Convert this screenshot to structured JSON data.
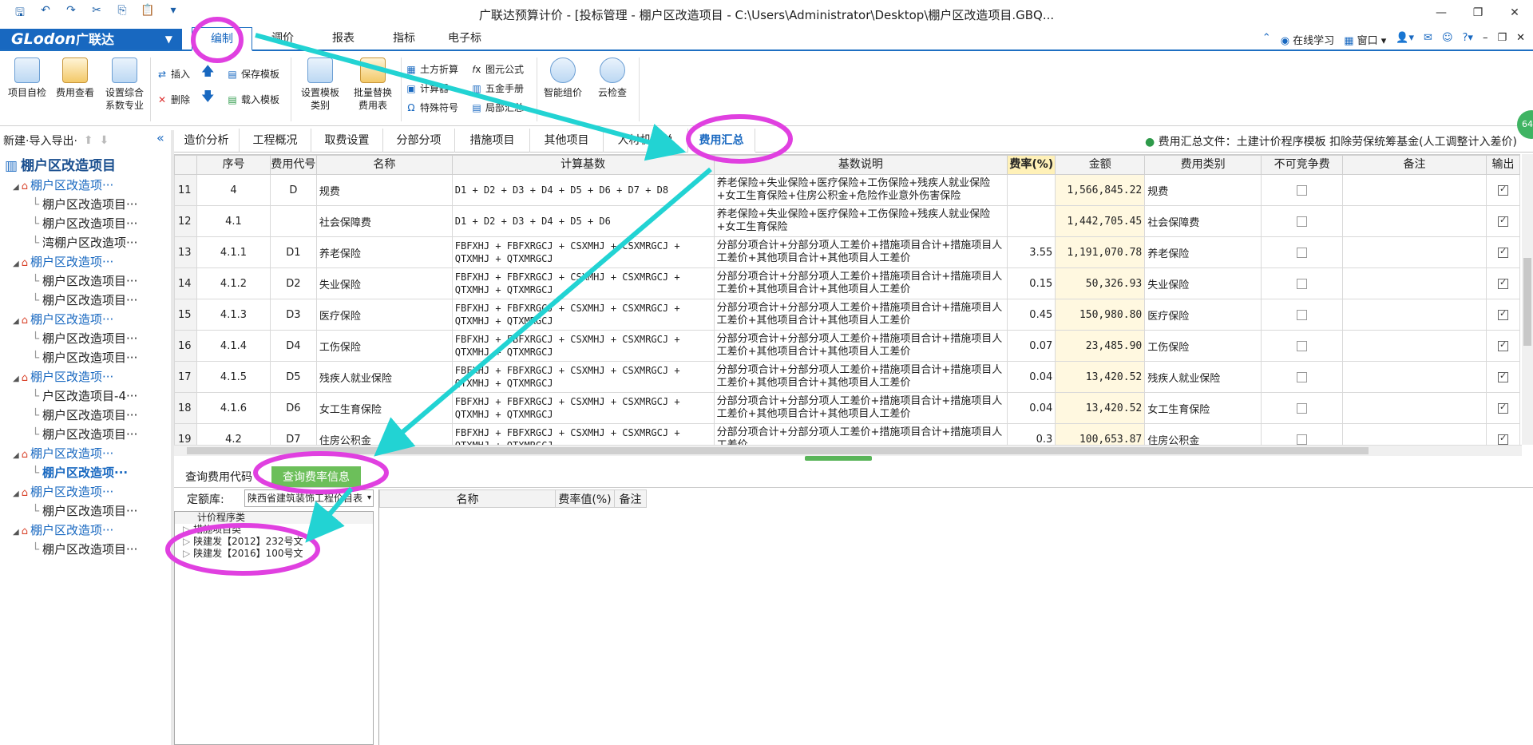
{
  "window": {
    "title": "广联达预算计价 - [投标管理 - 棚户区改造项目 - C:\\Users\\Administrator\\Desktop\\棚户区改造项目.GBQ..."
  },
  "logo": {
    "latin": "GLodon",
    "cn": "广联达"
  },
  "menu": [
    "编制",
    "调价",
    "报表",
    "指标",
    "电子标"
  ],
  "menu_right": {
    "online": "在线学习",
    "window": "窗口"
  },
  "ribbon": {
    "self_check": "项目自检",
    "fee_view": "费用查看",
    "set_rate": "设置综合",
    "set_rate2": "系数专业",
    "insert": "插入",
    "delete": "删除",
    "save_tpl": "保存模板",
    "load_tpl": "载入模板",
    "set_tpl_cat": "设置模板",
    "set_tpl_cat2": "类别",
    "batch_replace": "批量替换",
    "batch_replace2": "费用表",
    "earthwork": "土方折算",
    "calculator": "计算器",
    "special_symbol": "特殊符号",
    "element_formula": "图元公式",
    "hardware_manual": "五金手册",
    "local_summary": "局部汇总",
    "smart_price": "智能组价",
    "cloud_check": "云检查"
  },
  "left": {
    "header": "新建·导入导出·",
    "tree": [
      {
        "label": "棚户区改造项目",
        "level": "root"
      },
      {
        "label": "棚户区改造项···",
        "level": "l1"
      },
      {
        "label": "棚户区改造项目···",
        "level": "l2"
      },
      {
        "label": "棚户区改造项目···",
        "level": "l2"
      },
      {
        "label": "湾棚户区改造项···",
        "level": "l2"
      },
      {
        "label": "棚户区改造项···",
        "level": "l1"
      },
      {
        "label": "棚户区改造项目···",
        "level": "l2"
      },
      {
        "label": "棚户区改造项目···",
        "level": "l2"
      },
      {
        "label": "棚户区改造项···",
        "level": "l1"
      },
      {
        "label": "棚户区改造项目···",
        "level": "l2"
      },
      {
        "label": "棚户区改造项目···",
        "level": "l2"
      },
      {
        "label": "棚户区改造项···",
        "level": "l1"
      },
      {
        "label": "户区改造项目-4···",
        "level": "l2"
      },
      {
        "label": "棚户区改造项目···",
        "level": "l2"
      },
      {
        "label": "棚户区改造项目···",
        "level": "l2"
      },
      {
        "label": "棚户区改造项···",
        "level": "l1"
      },
      {
        "label": "棚户区改造项···",
        "level": "l2sel"
      },
      {
        "label": "棚户区改造项···",
        "level": "l1"
      },
      {
        "label": "棚户区改造项目···",
        "level": "l2"
      },
      {
        "label": "棚户区改造项···",
        "level": "l1"
      },
      {
        "label": "棚户区改造项目···",
        "level": "l2"
      }
    ]
  },
  "tabs": [
    "造价分析",
    "工程概况",
    "取费设置",
    "分部分项",
    "措施项目",
    "其他项目",
    "人材机汇总",
    "费用汇总"
  ],
  "fee_file": {
    "label": "费用汇总文件：土建计价程序模板 扣除劳保统筹基金(人工调整计入差价)"
  },
  "columns": [
    "",
    "序号",
    "费用代号",
    "名称",
    "计算基数",
    "基数说明",
    "费率(%)",
    "金额",
    "费用类别",
    "不可竞争费",
    "备注",
    "输出"
  ],
  "rows": [
    {
      "rn": "11",
      "seq": "4",
      "code": "D",
      "name": "规费",
      "base": "D1 + D2 + D3 + D4 + D5 + D6 + D7 + D8",
      "desc": "养老保险+失业保险+医疗保险+工伤保险+残疾人就业保险+女工生育保险+住房公积金+危险作业意外伤害保险",
      "rate": "",
      "amount": "1,566,845.22",
      "cat": "规费"
    },
    {
      "rn": "12",
      "seq": "4.1",
      "code": "",
      "name": "社会保障费",
      "base": "D1 + D2 + D3 + D4 + D5 + D6",
      "desc": "养老保险+失业保险+医疗保险+工伤保险+残疾人就业保险+女工生育保险",
      "rate": "",
      "amount": "1,442,705.45",
      "cat": "社会保障费"
    },
    {
      "rn": "13",
      "seq": "4.1.1",
      "code": "D1",
      "name": "养老保险",
      "base": "FBFXHJ + FBFXRGCJ + CSXMHJ + CSXMRGCJ + QTXMHJ + QTXMRGCJ",
      "desc": "分部分项合计+分部分项人工差价+措施项目合计+措施项目人工差价+其他项目合计+其他项目人工差价",
      "rate": "3.55",
      "amount": "1,191,070.78",
      "cat": "养老保险"
    },
    {
      "rn": "14",
      "seq": "4.1.2",
      "code": "D2",
      "name": "失业保险",
      "base": "FBFXHJ + FBFXRGCJ + CSXMHJ + CSXMRGCJ + QTXMHJ + QTXMRGCJ",
      "desc": "分部分项合计+分部分项人工差价+措施项目合计+措施项目人工差价+其他项目合计+其他项目人工差价",
      "rate": "0.15",
      "amount": "50,326.93",
      "cat": "失业保险"
    },
    {
      "rn": "15",
      "seq": "4.1.3",
      "code": "D3",
      "name": "医疗保险",
      "base": "FBFXHJ + FBFXRGCJ + CSXMHJ + CSXMRGCJ + QTXMHJ + QTXMRGCJ",
      "desc": "分部分项合计+分部分项人工差价+措施项目合计+措施项目人工差价+其他项目合计+其他项目人工差价",
      "rate": "0.45",
      "amount": "150,980.80",
      "cat": "医疗保险"
    },
    {
      "rn": "16",
      "seq": "4.1.4",
      "code": "D4",
      "name": "工伤保险",
      "base": "FBFXHJ + FBFXRGCJ + CSXMHJ + CSXMRGCJ + QTXMHJ + QTXMRGCJ",
      "desc": "分部分项合计+分部分项人工差价+措施项目合计+措施项目人工差价+其他项目合计+其他项目人工差价",
      "rate": "0.07",
      "amount": "23,485.90",
      "cat": "工伤保险"
    },
    {
      "rn": "17",
      "seq": "4.1.5",
      "code": "D5",
      "name": "残疾人就业保险",
      "base": "FBFXHJ + FBFXRGCJ + CSXMHJ + CSXMRGCJ + QTXMHJ + QTXMRGCJ",
      "desc": "分部分项合计+分部分项人工差价+措施项目合计+措施项目人工差价+其他项目合计+其他项目人工差价",
      "rate": "0.04",
      "amount": "13,420.52",
      "cat": "残疾人就业保险"
    },
    {
      "rn": "18",
      "seq": "4.1.6",
      "code": "D6",
      "name": "女工生育保险",
      "base": "FBFXHJ + FBFXRGCJ + CSXMHJ + CSXMRGCJ + QTXMHJ + QTXMRGCJ",
      "desc": "分部分项合计+分部分项人工差价+措施项目合计+措施项目人工差价+其他项目合计+其他项目人工差价",
      "rate": "0.04",
      "amount": "13,420.52",
      "cat": "女工生育保险"
    },
    {
      "rn": "19",
      "seq": "4.2",
      "code": "D7",
      "name": "住房公积金",
      "base": "FBFXHJ + FBFXRGCJ + CSXMHJ + CSXMRGCJ + QTXMHJ + QTXMRGCJ",
      "desc": "分部分项合计+分部分项人工差价+措施项目合计+措施项目人工差价",
      "rate": "0.3",
      "amount": "100,653.87",
      "cat": "住房公积金"
    }
  ],
  "bottom": {
    "tab_code": "查询费用代码",
    "tab_rate": "查询费率信息",
    "dinge_label": "定额库:",
    "dinge_value": "陕西省建筑装饰工程价目表",
    "tree": [
      "计价程序类",
      "措施项目类",
      "陕建发【2012】232号文",
      "陕建发【2016】100号文"
    ],
    "right_cols": [
      "名称",
      "费率值(%)",
      "备注"
    ]
  },
  "badge": "64"
}
